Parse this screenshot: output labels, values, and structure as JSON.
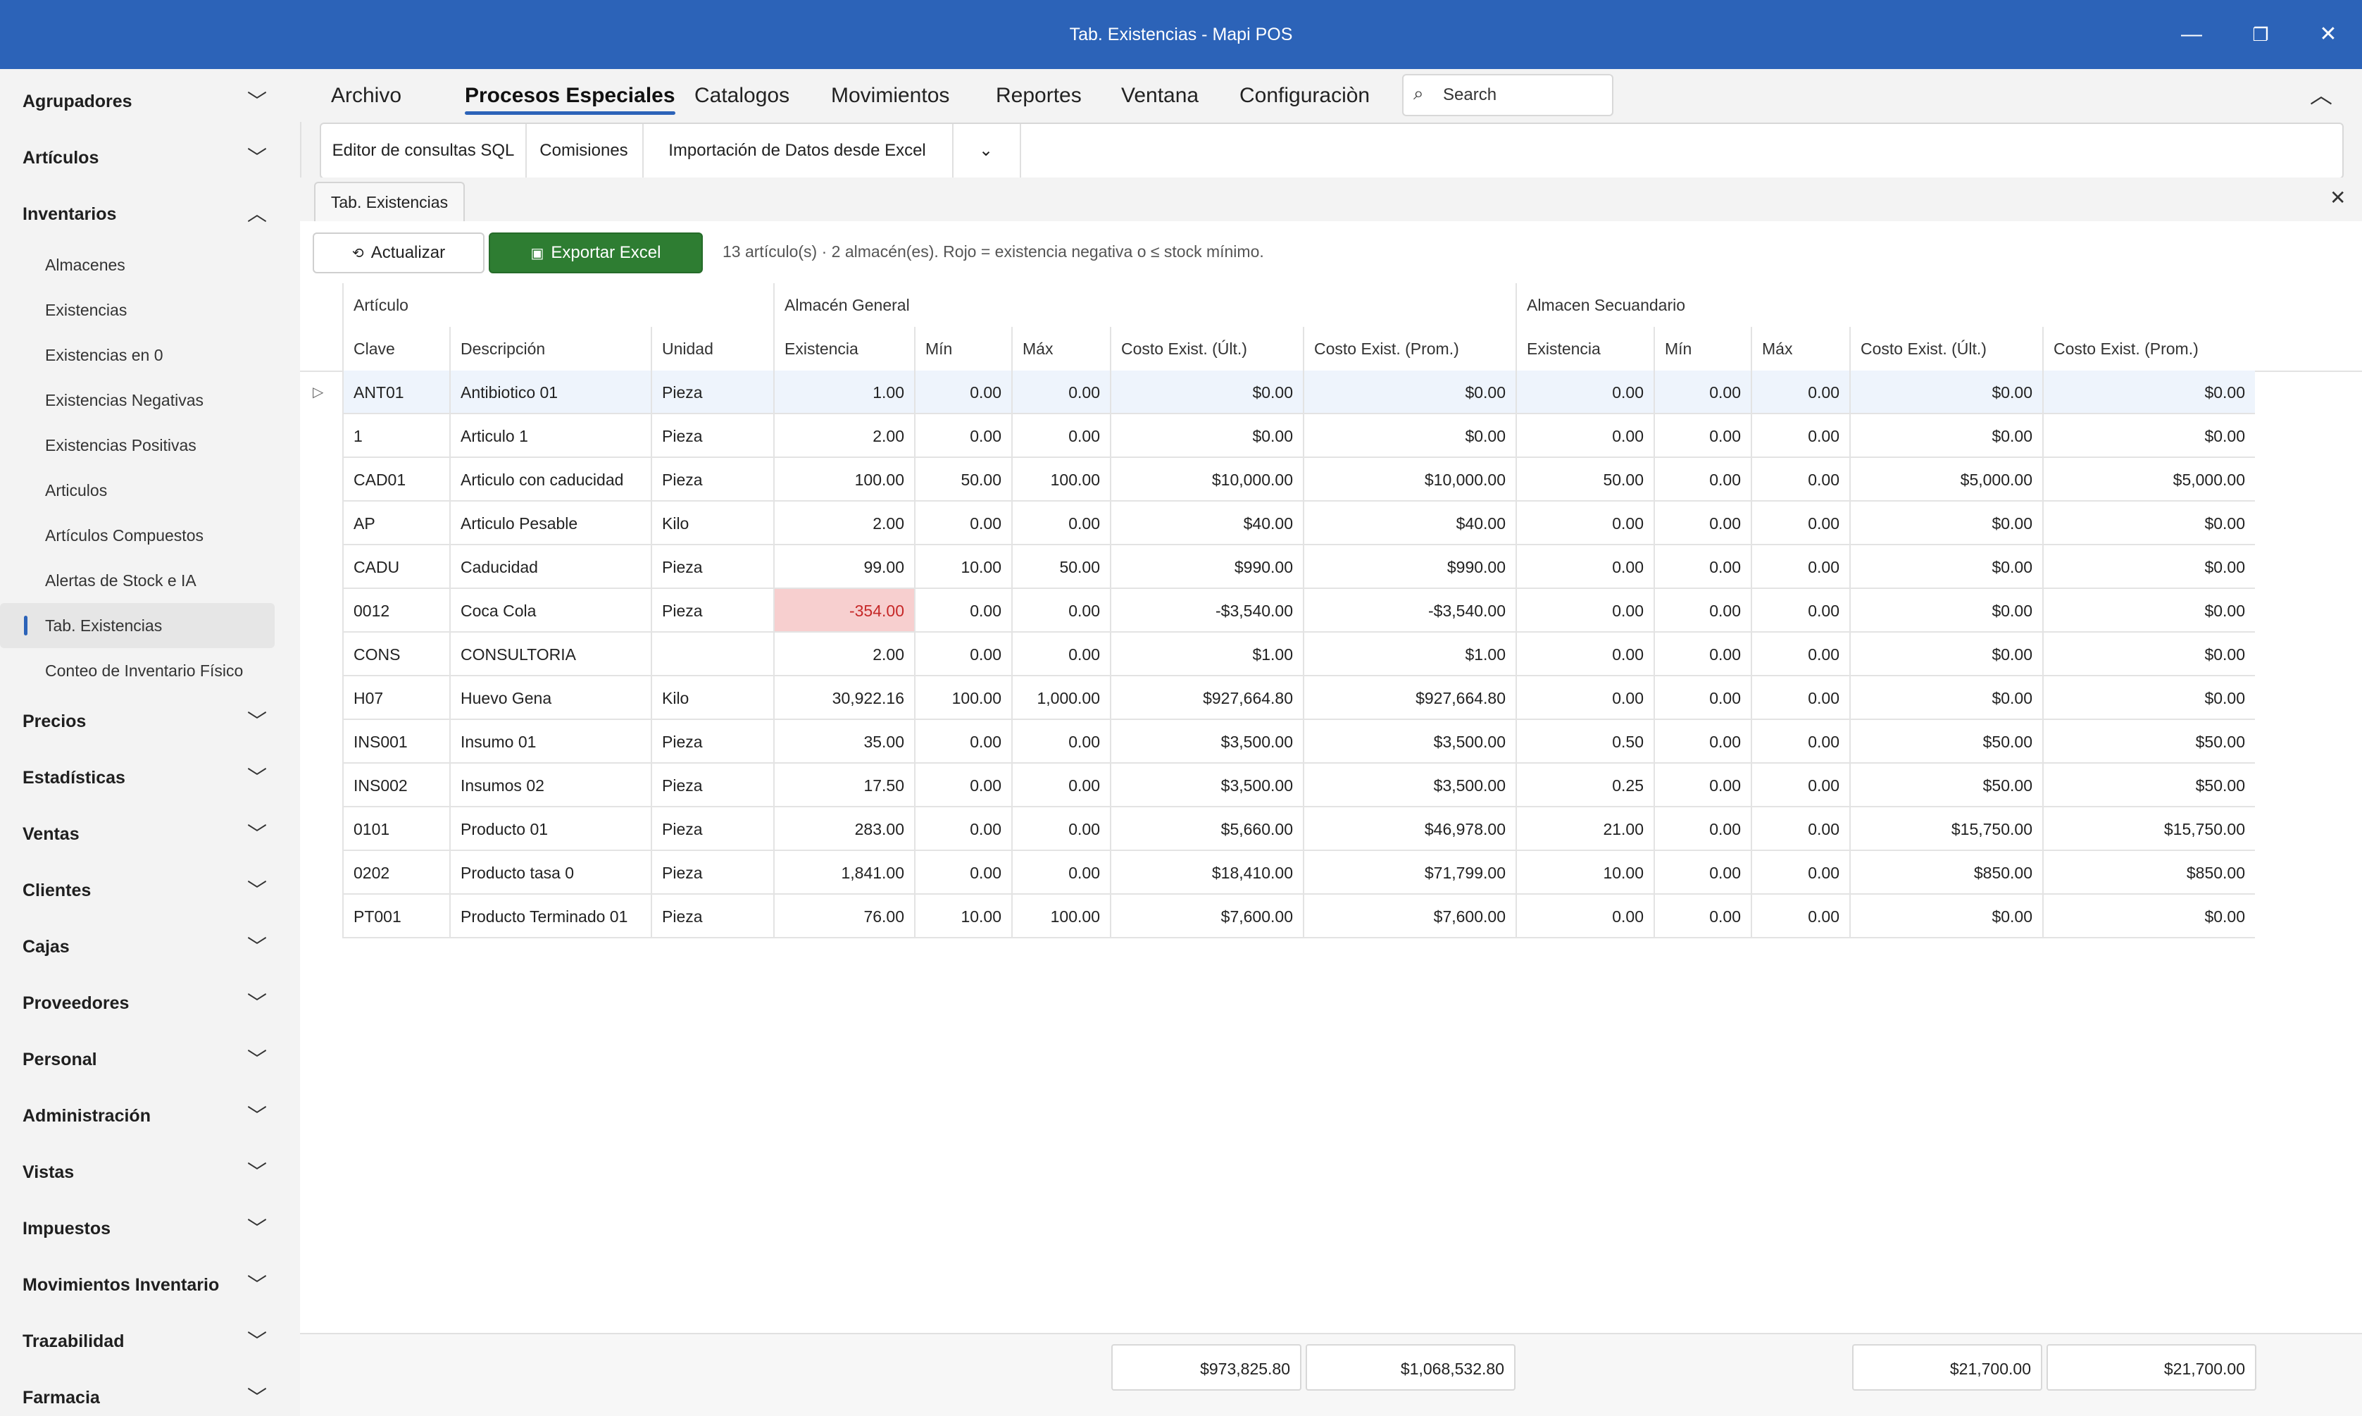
{
  "window": {
    "title": "Tab. Existencias - Mapi POS",
    "controls": {
      "minimize": "—",
      "restore": "❐",
      "close": "✕"
    }
  },
  "sidebar": {
    "sections": [
      {
        "label": "Agrupadores",
        "expanded": false
      },
      {
        "label": "Artículos",
        "expanded": false
      },
      {
        "label": "Inventarios",
        "expanded": true,
        "items": [
          {
            "label": "Almacenes"
          },
          {
            "label": "Existencias"
          },
          {
            "label": "Existencias en 0"
          },
          {
            "label": "Existencias Negativas"
          },
          {
            "label": "Existencias Positivas"
          },
          {
            "label": "Articulos"
          },
          {
            "label": "Artículos Compuestos"
          },
          {
            "label": "Alertas de Stock e IA"
          },
          {
            "label": "Tab. Existencias",
            "active": true
          },
          {
            "label": "Conteo de Inventario Físico"
          }
        ]
      },
      {
        "label": "Precios",
        "expanded": false
      },
      {
        "label": "Estadísticas",
        "expanded": false
      },
      {
        "label": "Ventas",
        "expanded": false
      },
      {
        "label": "Clientes",
        "expanded": false
      },
      {
        "label": "Cajas",
        "expanded": false
      },
      {
        "label": "Proveedores",
        "expanded": false
      },
      {
        "label": "Personal",
        "expanded": false
      },
      {
        "label": "Administración",
        "expanded": false
      },
      {
        "label": "Vistas",
        "expanded": false
      },
      {
        "label": "Impuestos",
        "expanded": false
      },
      {
        "label": "Movimientos Inventario",
        "expanded": false
      },
      {
        "label": "Trazabilidad",
        "expanded": false
      },
      {
        "label": "Farmacia",
        "expanded": false
      }
    ]
  },
  "menubar": {
    "items": [
      "Archivo",
      "Procesos Especiales",
      "Catalogos",
      "Movimientos",
      "Reportes",
      "Ventana",
      "Configuraciòn"
    ],
    "active": "Procesos Especiales",
    "search_placeholder": "Search"
  },
  "ribbon": {
    "buttons": [
      "Editor de consultas SQL",
      "Comisiones",
      "Importación de Datos desde Excel"
    ],
    "more": "⌄"
  },
  "document_tab": {
    "label": "Tab. Existencias"
  },
  "toolbar": {
    "refresh_label": "Actualizar",
    "export_label": "Exportar Excel",
    "status": "13 artículo(s) · 2 almacén(es). Rojo = existencia negativa o ≤ stock mínimo."
  },
  "grid": {
    "groups": [
      "Artículo",
      "Almacén General",
      "Almacen Secuandario"
    ],
    "columns": [
      "Clave",
      "Descripción",
      "Unidad",
      "Existencia",
      "Mín",
      "Máx",
      "Costo Exist. (Últ.)",
      "Costo Exist. (Prom.)",
      "Existencia",
      "Mín",
      "Máx",
      "Costo Exist. (Últ.)",
      "Costo Exist. (Prom.)"
    ],
    "rows": [
      [
        "ANT01",
        "Antibiotico 01",
        "Pieza",
        "1.00",
        "0.00",
        "0.00",
        "$0.00",
        "$0.00",
        "0.00",
        "0.00",
        "0.00",
        "$0.00",
        "$0.00"
      ],
      [
        "1",
        "Articulo 1",
        "Pieza",
        "2.00",
        "0.00",
        "0.00",
        "$0.00",
        "$0.00",
        "0.00",
        "0.00",
        "0.00",
        "$0.00",
        "$0.00"
      ],
      [
        "CAD01",
        "Articulo con caducidad",
        "Pieza",
        "100.00",
        "50.00",
        "100.00",
        "$10,000.00",
        "$10,000.00",
        "50.00",
        "0.00",
        "0.00",
        "$5,000.00",
        "$5,000.00"
      ],
      [
        "AP",
        "Articulo Pesable",
        "Kilo",
        "2.00",
        "0.00",
        "0.00",
        "$40.00",
        "$40.00",
        "0.00",
        "0.00",
        "0.00",
        "$0.00",
        "$0.00"
      ],
      [
        "CADU",
        "Caducidad",
        "Pieza",
        "99.00",
        "10.00",
        "50.00",
        "$990.00",
        "$990.00",
        "0.00",
        "0.00",
        "0.00",
        "$0.00",
        "$0.00"
      ],
      [
        "0012",
        "Coca Cola",
        "Pieza",
        "-354.00",
        "0.00",
        "0.00",
        "-$3,540.00",
        "-$3,540.00",
        "0.00",
        "0.00",
        "0.00",
        "$0.00",
        "$0.00"
      ],
      [
        "CONS",
        "CONSULTORIA",
        "",
        "2.00",
        "0.00",
        "0.00",
        "$1.00",
        "$1.00",
        "0.00",
        "0.00",
        "0.00",
        "$0.00",
        "$0.00"
      ],
      [
        "H07",
        "Huevo Gena",
        "Kilo",
        "30,922.16",
        "100.00",
        "1,000.00",
        "$927,664.80",
        "$927,664.80",
        "0.00",
        "0.00",
        "0.00",
        "$0.00",
        "$0.00"
      ],
      [
        "INS001",
        "Insumo 01",
        "Pieza",
        "35.00",
        "0.00",
        "0.00",
        "$3,500.00",
        "$3,500.00",
        "0.50",
        "0.00",
        "0.00",
        "$50.00",
        "$50.00"
      ],
      [
        "INS002",
        "Insumos 02",
        "Pieza",
        "17.50",
        "0.00",
        "0.00",
        "$3,500.00",
        "$3,500.00",
        "0.25",
        "0.00",
        "0.00",
        "$50.00",
        "$50.00"
      ],
      [
        "0101",
        "Producto 01",
        "Pieza",
        "283.00",
        "0.00",
        "0.00",
        "$5,660.00",
        "$46,978.00",
        "21.00",
        "0.00",
        "0.00",
        "$15,750.00",
        "$15,750.00"
      ],
      [
        "0202",
        "Producto tasa 0",
        "Pieza",
        "1,841.00",
        "0.00",
        "0.00",
        "$18,410.00",
        "$71,799.00",
        "10.00",
        "0.00",
        "0.00",
        "$850.00",
        "$850.00"
      ],
      [
        "PT001",
        "Producto Terminado 01",
        "Pieza",
        "76.00",
        "10.00",
        "100.00",
        "$7,600.00",
        "$7,600.00",
        "0.00",
        "0.00",
        "0.00",
        "$0.00",
        "$0.00"
      ]
    ],
    "selected_row": 0,
    "negative_cells": [
      [
        5,
        3
      ]
    ],
    "totals": {
      "general_ult": "$973,825.80",
      "general_prom": "$1,068,532.80",
      "secundario_ult": "$21,700.00",
      "secundario_prom": "$21,700.00"
    },
    "colors": {
      "negative_bg": "#f7cfcf",
      "negative_text": "#c62828",
      "accent": "#2c63b8",
      "excel_green": "#2e7d32"
    }
  }
}
